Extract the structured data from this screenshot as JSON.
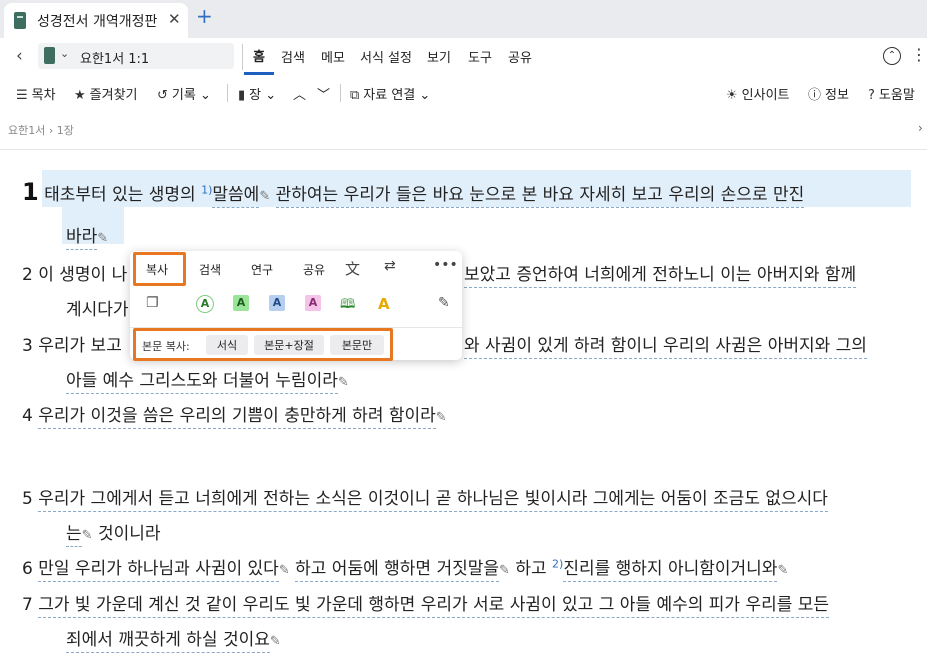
{
  "tab": {
    "title": "성경전서 개역개정판",
    "close": "✕",
    "new": "+"
  },
  "nav": {
    "reference": "요한1서 1:1",
    "menus": [
      "홈",
      "검색",
      "메모",
      "서식 설정",
      "보기",
      "도구",
      "공유"
    ]
  },
  "toolbar": {
    "toc": "목차",
    "favorites": "즐겨찾기",
    "history": "기록",
    "chapter": "장",
    "resource_link": "자료 연결",
    "insight": "인사이트",
    "info": "정보",
    "help": "도움말"
  },
  "breadcrumb": {
    "book": "요한1서",
    "sep": "›",
    "chapter": "1장"
  },
  "verses": {
    "v1_num": "1",
    "v1_a": "태초부터 있는 생명의",
    "v1_sup": "1)",
    "v1_b": "말씀에",
    "v1_c": "관하여는 우리가 들은 바요 눈으로 본 바요 자세히 보고 우리의 손으로 만진",
    "v1_d": "바라",
    "v2_num": "2",
    "v2_a": "이 생명이 나",
    "v2_b": "보았고 증언하여 너희에게 전하노니 이는 아버지와 함께",
    "v2_c": "계시다가",
    "v3_num": "3",
    "v3_a": "우리가 보고",
    "v3_b": "와 사귐이 있게 하려 함이니 우리의 사귐은 아버지와 그의",
    "v3_c": "아들 예수 그리스도와 더불어 누림이라",
    "v4_num": "4",
    "v4_a": "우리가 이것을 씀은 우리의 기쁨이 충만하게 하려 함이라",
    "v5_num": "5",
    "v5_a": "우리가 그에게서 듣고 너희에게 전하는 소식은 이것이니 곧 하나님은 빛이시라 그에게는 어둠이 조금도 없으시다",
    "v5_b": "는",
    "v5_c": "것이니라",
    "v6_num": "6",
    "v6_a": "만일 우리가 하나님과 사귐이 있다",
    "v6_b": "하고 어둠에 행하면 거짓말을",
    "v6_c": "하고",
    "v6_sup": "2)",
    "v6_d": "진리를 행하지 아니함이거니와",
    "v7_num": "7",
    "v7_a": "그가 빛 가운데 계신 것 같이 우리도 빛 가운데 행하면 우리가 서로 사귐이 있고 그 아들 예수의 피가 우리를 모든",
    "v7_b": "죄에서 깨끗하게 하실 것이요"
  },
  "popup": {
    "tabs": [
      "복사",
      "검색",
      "연구",
      "공유"
    ],
    "highlight_letter": "A",
    "copy_label": "본문 복사:",
    "copy_options": [
      "서식",
      "본문+장절",
      "본문만"
    ]
  },
  "colors": {
    "accent": "#1f5fbf",
    "highlight_box": "#e87722",
    "verse_highlight": "#e1effa"
  }
}
